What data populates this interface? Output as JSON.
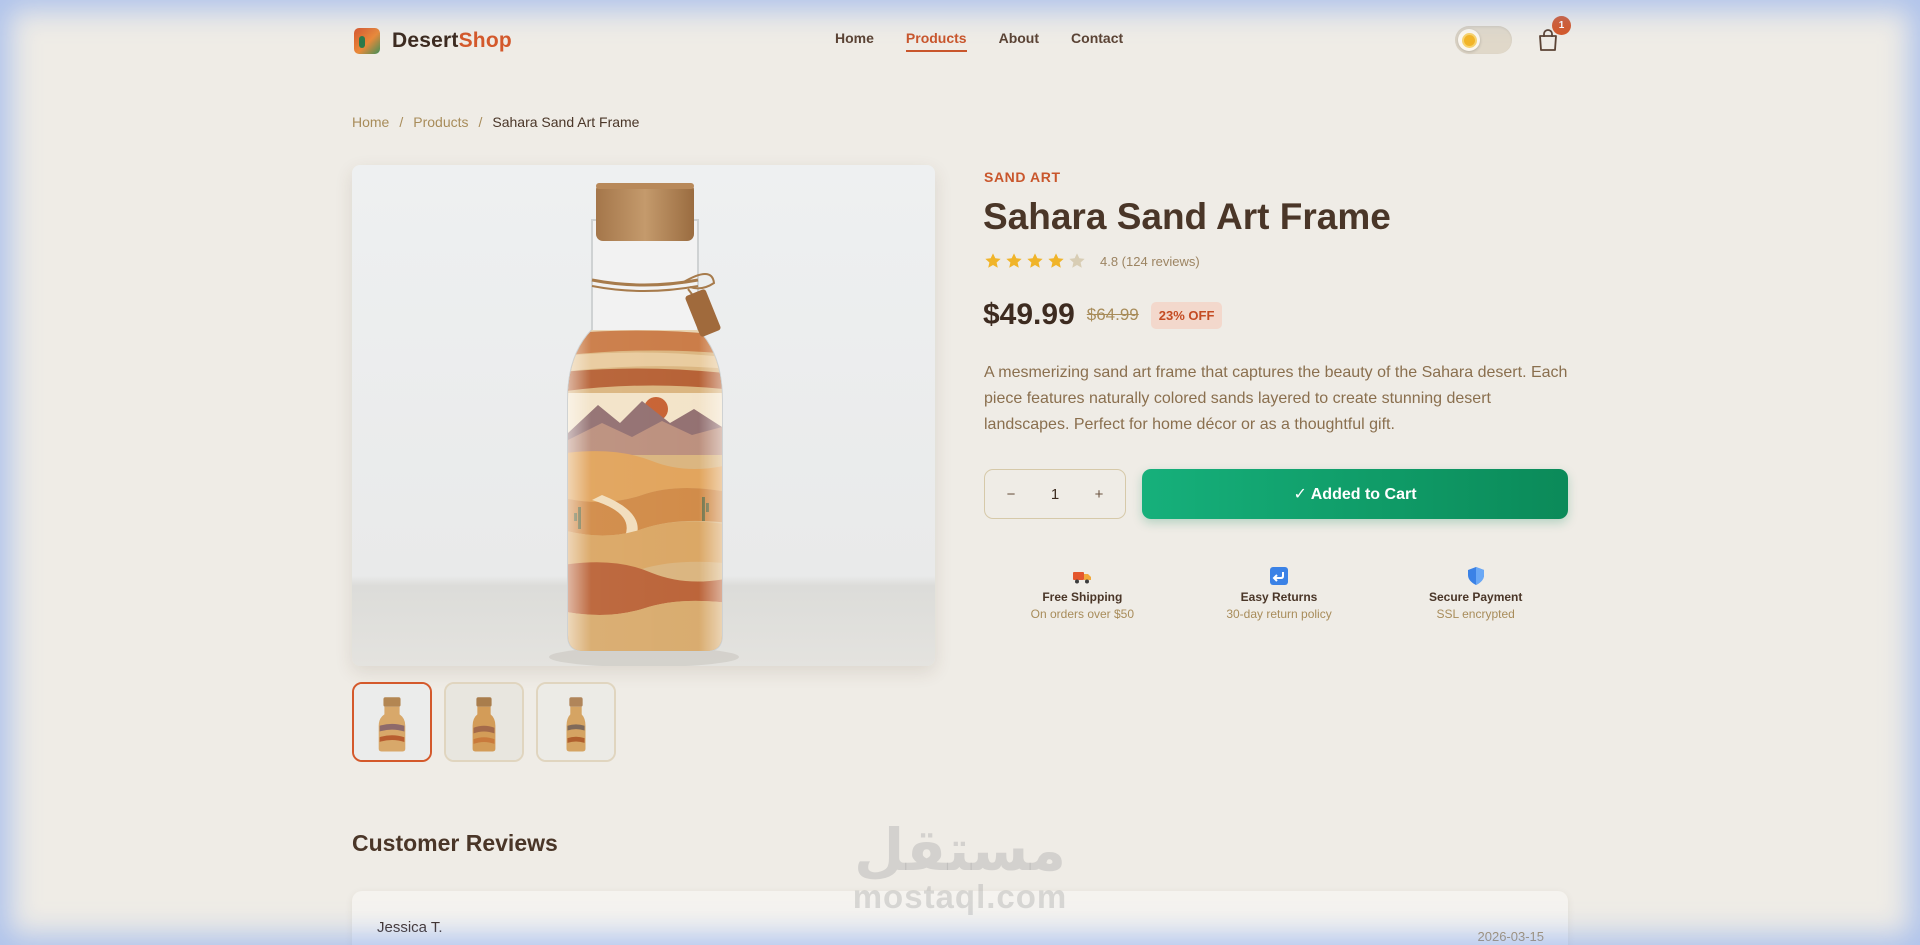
{
  "header": {
    "brand_primary": "Desert",
    "brand_accent": "Shop",
    "nav": [
      {
        "label": "Home",
        "active": false
      },
      {
        "label": "Products",
        "active": true
      },
      {
        "label": "About",
        "active": false
      },
      {
        "label": "Contact",
        "active": false
      }
    ],
    "theme_toggle_icon": "sun-icon",
    "cart_icon": "shopping-bag-icon",
    "cart_count": "1"
  },
  "breadcrumb": {
    "items": [
      "Home",
      "Products"
    ],
    "separator": "/",
    "current": "Sahara Sand Art Frame"
  },
  "gallery": {
    "thumbnail_count": 3,
    "active_thumbnail": 0
  },
  "product": {
    "category": "SAND ART",
    "title": "Sahara Sand Art Frame",
    "rating_stars": 4,
    "rating_text": "4.8 (124 reviews)",
    "price": "$49.99",
    "old_price": "$64.99",
    "discount": "23% OFF",
    "description": "A mesmerizing sand art frame that captures the beauty of the Sahara desert. Each piece features naturally colored sands layered to create stunning desert landscapes. Perfect for home décor or as a thoughtful gift.",
    "quantity": "1",
    "qty_minus": "−",
    "qty_plus": "+",
    "add_button": "✓ Added to Cart"
  },
  "features": [
    {
      "icon": "truck-icon",
      "title": "Free Shipping",
      "subtitle": "On orders over $50"
    },
    {
      "icon": "return-arrow-icon",
      "title": "Easy Returns",
      "subtitle": "30-day return policy"
    },
    {
      "icon": "shield-icon",
      "title": "Secure Payment",
      "subtitle": "SSL encrypted"
    }
  ],
  "reviews": {
    "heading": "Customer Reviews",
    "items": [
      {
        "name": "Jessica T.",
        "date": "2026-03-15"
      }
    ]
  },
  "watermark": {
    "arabic": "مستقل",
    "latin": "mostaql.com"
  },
  "colors": {
    "accent": "#d4592b",
    "success": "#10a070",
    "background": "#efece6",
    "text": "#4a3628"
  }
}
